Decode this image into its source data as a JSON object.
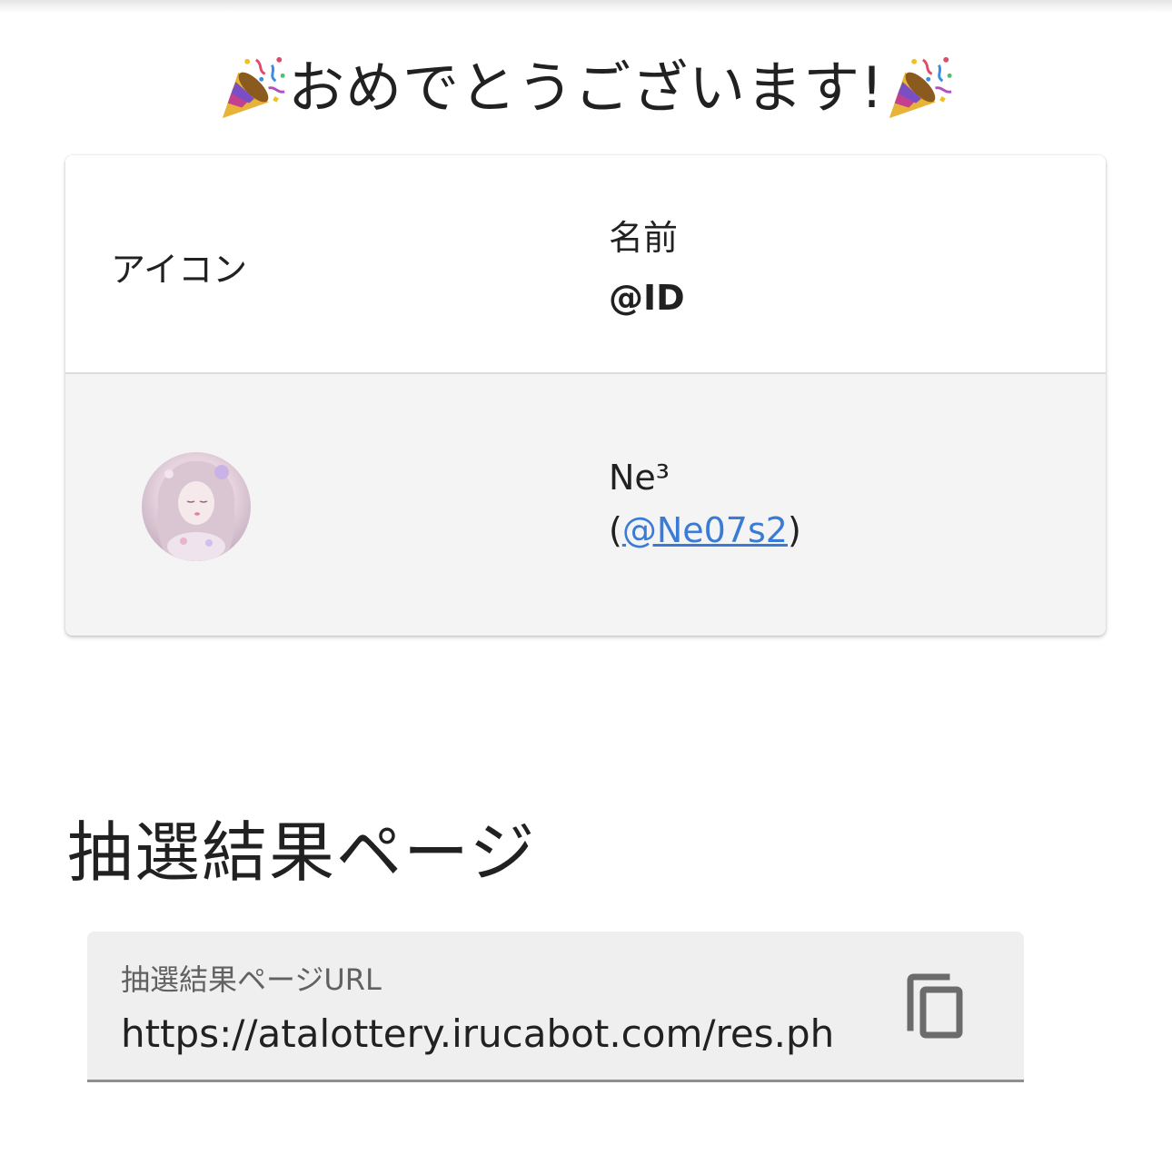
{
  "heading": {
    "text": "おめでとうございます!"
  },
  "table": {
    "header": {
      "icon_label": "アイコン",
      "name_label": "名前",
      "id_label": "@ID"
    },
    "rows": [
      {
        "name": "Ne³",
        "id_prefix": "(",
        "id_link": "@Ne07s2",
        "id_suffix": ")"
      }
    ]
  },
  "result_section": {
    "title": "抽選結果ページ",
    "field_label": "抽選結果ページURL",
    "field_value": "https://atalottery.irucabot.com/res.ph"
  },
  "icons": {
    "party": "party-popper-icon",
    "copy": "copy-icon"
  },
  "colors": {
    "link": "#3a7bd5",
    "row_background": "#f4f4f4",
    "field_background": "#efefef"
  }
}
